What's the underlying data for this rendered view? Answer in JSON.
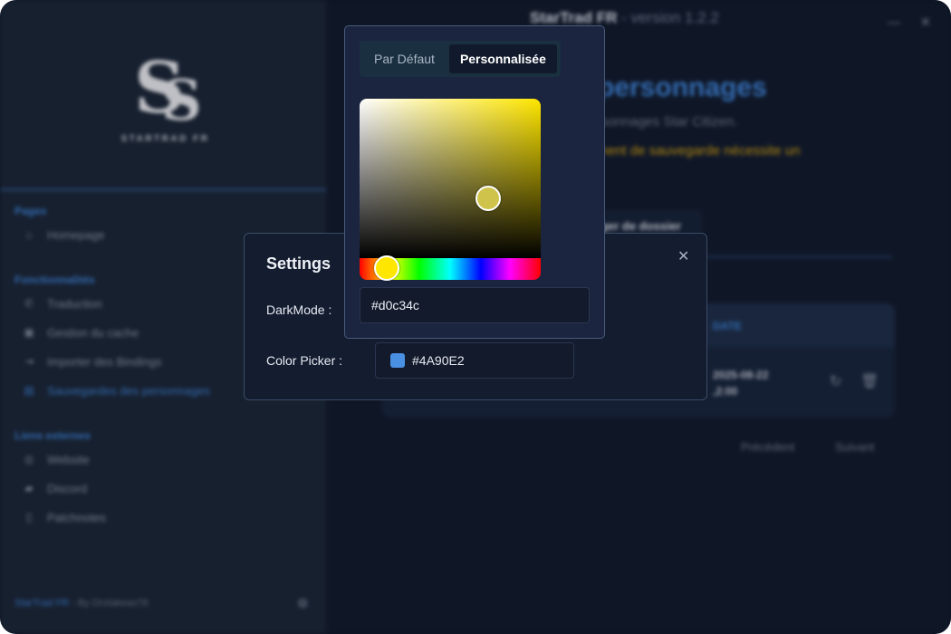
{
  "app": {
    "logo_text": "STARTRAD FR",
    "title_name": "StarTrad FR",
    "title_version": " - version 1.2.2",
    "minimize_glyph": "—",
    "close_glyph": "✕"
  },
  "sidebar": {
    "section_pages": "Pages",
    "section_features": "Fonctionnalités",
    "section_links": "Liens externes",
    "pages": [
      {
        "label": "Homepage",
        "icon": "home-icon"
      }
    ],
    "features": [
      {
        "label": "Traduction",
        "icon": "phone-icon"
      },
      {
        "label": "Gestion du cache",
        "icon": "cache-icon"
      },
      {
        "label": "Importer des Bindings",
        "icon": "import-icon"
      },
      {
        "label": "Sauvegardes des personnages",
        "icon": "save-icon",
        "active": true
      }
    ],
    "links": [
      {
        "label": "Website",
        "icon": "globe-icon"
      },
      {
        "label": "Discord",
        "icon": "discord-icon"
      },
      {
        "label": "Patchnotes",
        "icon": "document-icon"
      }
    ],
    "footer_brand": "StarTrad FR",
    "footer_by": " - By Drolakeas78"
  },
  "main": {
    "title_partial": "personnages",
    "desc_partial": "ersonnages Star Citizen.",
    "warning_partial": "ement de sauvegarde nécessite un",
    "tab_label": "ger de dossier",
    "table_header": "DATE",
    "table_date_1": "2025-08-22",
    "table_date_2": ",2:00",
    "prev_label": "Précédent",
    "next_label": "Suivant"
  },
  "settings": {
    "title": "Settings",
    "close_glyph": "✕",
    "darkmode_label": "DarkMode :",
    "colorpicker_label": "Color Picker :",
    "color_value": "#4A90E2"
  },
  "picker": {
    "tab_default": "Par Défaut",
    "tab_custom": "Personnalisée",
    "active_tab": "custom",
    "hex_value": "#d0c34c",
    "hue_color": "#ffe600"
  }
}
